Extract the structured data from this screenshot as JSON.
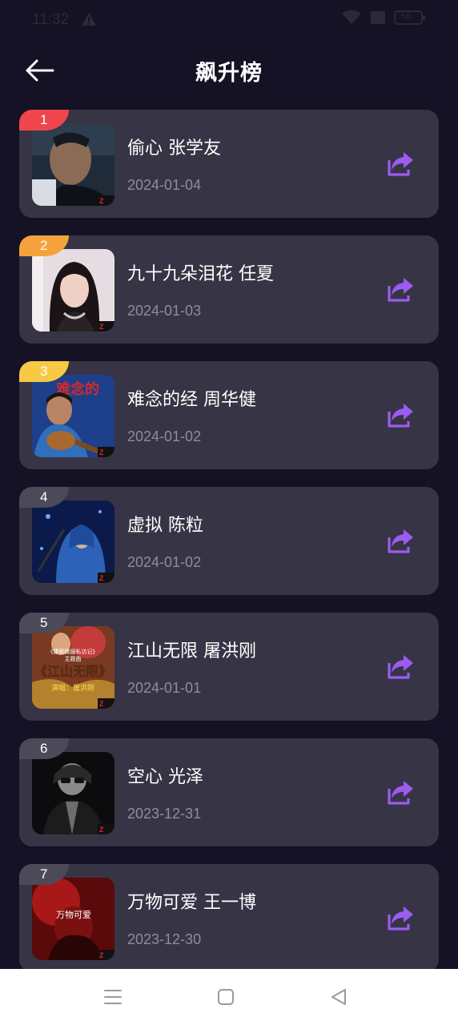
{
  "status_bar": {
    "time": "11:32",
    "battery": "58"
  },
  "header": {
    "title": "飙升榜"
  },
  "songs": [
    {
      "rank": "1",
      "title": "偷心 张学友",
      "date": "2024-01-04",
      "rank_color": "#f0454d"
    },
    {
      "rank": "2",
      "title": "九十九朵泪花 任夏",
      "date": "2024-01-03",
      "rank_color": "#f6a23a"
    },
    {
      "rank": "3",
      "title": "难念的经 周华健",
      "date": "2024-01-02",
      "rank_color": "#f7c945"
    },
    {
      "rank": "4",
      "title": "虚拟 陈粒",
      "date": "2024-01-02",
      "rank_color": "#4c4a58"
    },
    {
      "rank": "5",
      "title": "江山无限 屠洪刚",
      "date": "2024-01-01",
      "rank_color": "#4c4a58"
    },
    {
      "rank": "6",
      "title": "空心 光泽",
      "date": "2023-12-31",
      "rank_color": "#4c4a58"
    },
    {
      "rank": "7",
      "title": "万物可爱 王一博",
      "date": "2023-12-30",
      "rank_color": "#4c4a58"
    }
  ],
  "covers": {
    "c3_text": "难念的",
    "c5_line1": "《康熙微服私访记》",
    "c5_line2": "主题曲",
    "c5_title": "《江山无限》",
    "c5_singer": "演唱：屠洪刚",
    "c7_text": "万物可爱"
  },
  "colors": {
    "background": "#141224",
    "card": "#373445",
    "accent_share": "#9b5cf0",
    "date_text": "#8f8c9e"
  }
}
